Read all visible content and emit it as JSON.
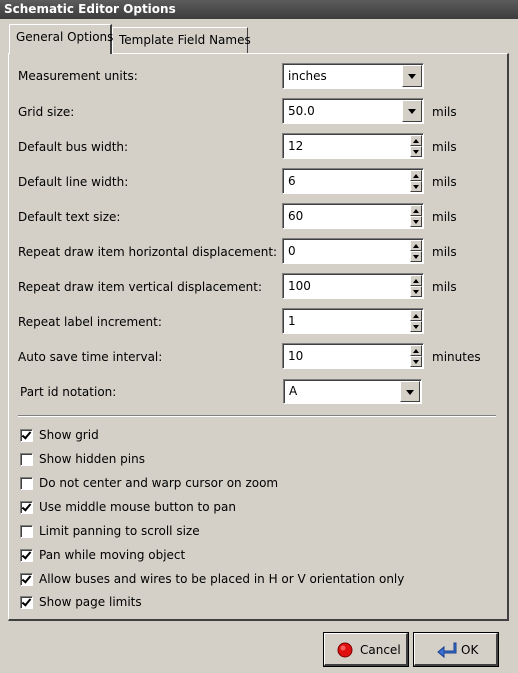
{
  "window": {
    "title": "Schematic Editor Options"
  },
  "tabs": [
    {
      "label": "General Options",
      "active": true
    },
    {
      "label": "Template Field Names",
      "active": false
    }
  ],
  "fields": {
    "measurement_units": {
      "label": "Measurement units:",
      "value": "inches",
      "unit": ""
    },
    "grid_size": {
      "label": "Grid size:",
      "value": "50.0",
      "unit": "mils"
    },
    "default_bus_width": {
      "label": "Default bus width:",
      "value": "12",
      "unit": "mils"
    },
    "default_line_width": {
      "label": "Default line width:",
      "value": "6",
      "unit": "mils"
    },
    "default_text_size": {
      "label": "Default text size:",
      "value": "60",
      "unit": "mils"
    },
    "repeat_h_disp": {
      "label": "Repeat draw item horizontal displacement:",
      "value": "0",
      "unit": "mils"
    },
    "repeat_v_disp": {
      "label": "Repeat draw item vertical displacement:",
      "value": "100",
      "unit": "mils"
    },
    "repeat_label_inc": {
      "label": "Repeat label increment:",
      "value": "1",
      "unit": ""
    },
    "auto_save": {
      "label": "Auto save time interval:",
      "value": "10",
      "unit": "minutes"
    },
    "part_id": {
      "label": "Part id notation:",
      "value": "A",
      "unit": ""
    }
  },
  "options": [
    {
      "label": "Show grid",
      "checked": true
    },
    {
      "label": "Show hidden pins",
      "checked": false
    },
    {
      "label": "Do not center and warp cursor on zoom",
      "checked": false
    },
    {
      "label": "Use middle mouse button to pan",
      "checked": true
    },
    {
      "label": "Limit panning to scroll size",
      "checked": false
    },
    {
      "label": "Pan while moving object",
      "checked": true
    },
    {
      "label": "Allow buses and wires to be placed in H or V orientation only",
      "checked": true
    },
    {
      "label": "Show page limits",
      "checked": true
    }
  ],
  "buttons": {
    "cancel": "Cancel",
    "ok": "OK"
  },
  "icons": {
    "cancel": "red-circle-icon",
    "ok": "enter-arrow-icon"
  },
  "colors": {
    "titlebar": "#4a4a4a",
    "face": "#d4d0c8",
    "cancel_icon": "#e01010",
    "ok_icon": "#3a6fd8"
  }
}
